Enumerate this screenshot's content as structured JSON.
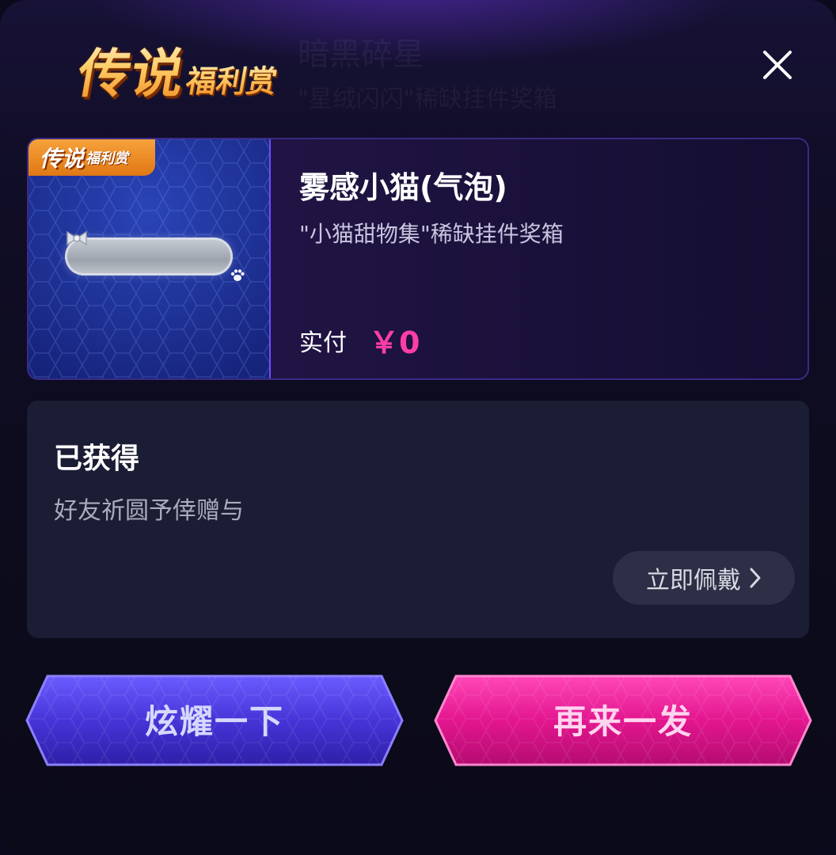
{
  "background_hint": {
    "line1": "暗黑碎星",
    "line2": "\"星绒闪闪\"稀缺挂件奖箱"
  },
  "logo": {
    "big": "传说",
    "small": "福利赏"
  },
  "prize": {
    "tag_big": "传说",
    "tag_small": "福利赏",
    "name": "雾感小猫(气泡)",
    "source": "\"小猫甜物集\"稀缺挂件奖箱",
    "pay_label": "实付",
    "pay_value": "￥0"
  },
  "acquired": {
    "title": "已获得",
    "desc": "好友祈圆予倖赠与",
    "wear_label": "立即佩戴"
  },
  "actions": {
    "show_label": "炫耀一下",
    "again_label": "再来一发"
  },
  "colors": {
    "accent_pink": "#ff3da8",
    "button_blue": "#4534d6",
    "button_pink": "#e4168f",
    "panel": "#1a1d33"
  },
  "icons": [
    "close-icon",
    "chevron-right-icon",
    "bubble-frame-icon",
    "paw-icon",
    "bow-icon"
  ]
}
